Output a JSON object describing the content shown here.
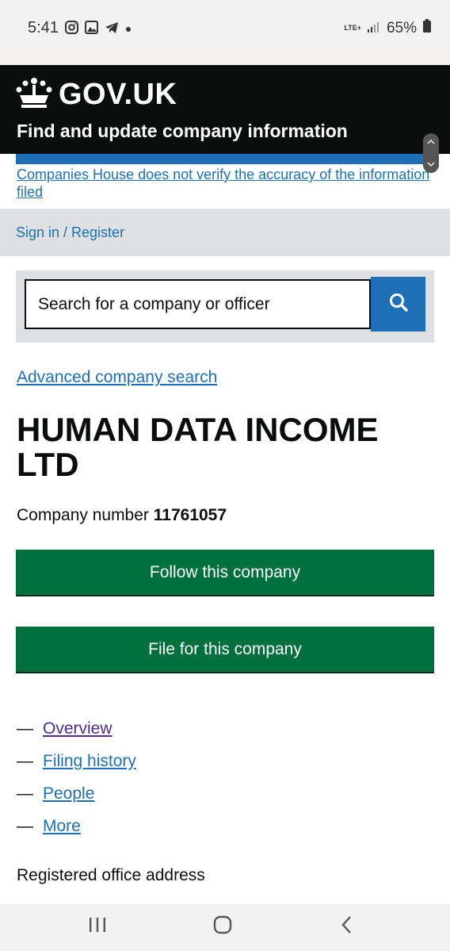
{
  "status_bar": {
    "time": "5:41",
    "network": "LTE+",
    "battery": "65%"
  },
  "header": {
    "logo_text": "GOV.UK",
    "service_name": "Find and update company information"
  },
  "disclaimer": "Companies House does not verify the accuracy of the information filed",
  "signin": "Sign in / Register",
  "search": {
    "placeholder": "Search for a company or officer"
  },
  "advanced_search": "Advanced company search",
  "company": {
    "name": "HUMAN DATA INCOME LTD",
    "number_label": "Company number",
    "number": "11761057"
  },
  "buttons": {
    "follow": "Follow this company",
    "file": "File for this company"
  },
  "nav": {
    "dash": "—",
    "items": [
      {
        "label": "Overview"
      },
      {
        "label": "Filing history"
      },
      {
        "label": "People"
      },
      {
        "label": "More"
      }
    ]
  },
  "section": {
    "registered_office_label": "Registered office address"
  },
  "icons": [
    "instagram-icon",
    "gallery-icon",
    "telegram-icon",
    "dot-icon",
    "signal-icon",
    "battery-icon",
    "crown-icon",
    "search-icon",
    "recents-icon",
    "home-icon",
    "back-icon"
  ],
  "colors": {
    "header_bg": "#0b0c0c",
    "link": "#1d70b8",
    "visited_link": "#4c2c92",
    "button_green": "#00703c"
  }
}
